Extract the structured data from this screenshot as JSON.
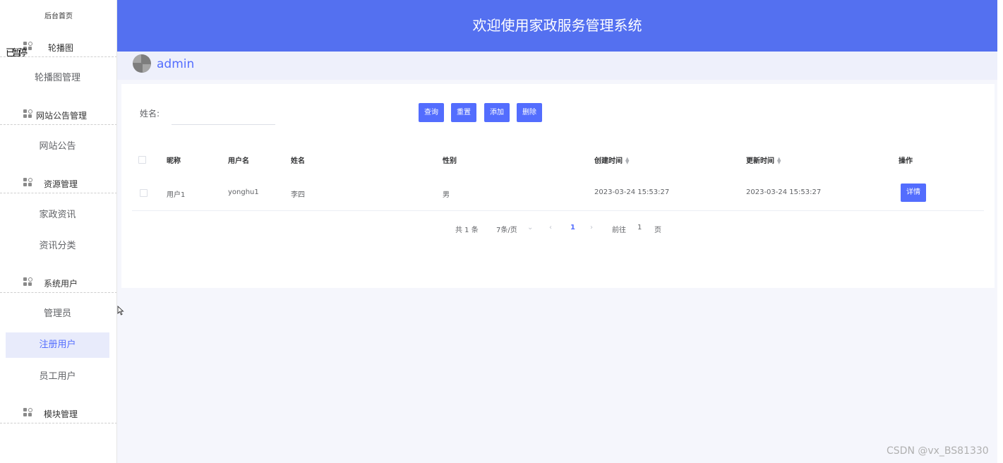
{
  "sidebar": {
    "home": "后台首页",
    "overlay_text": "已暂停",
    "groups": [
      {
        "label": "轮播图",
        "items": [
          "轮播图管理"
        ]
      },
      {
        "label": "网站公告管理",
        "items": [
          "网站公告"
        ]
      },
      {
        "label": "资源管理",
        "items": [
          "家政资讯",
          "资讯分类"
        ]
      },
      {
        "label": "系统用户",
        "items": [
          "管理员",
          "注册用户",
          "员工用户"
        ]
      },
      {
        "label": "模块管理",
        "items": []
      }
    ],
    "active_item": "注册用户"
  },
  "header": {
    "title": "欢迎使用家政服务管理系统"
  },
  "user": {
    "name": "admin"
  },
  "search": {
    "label": "姓名:",
    "value": "",
    "placeholder": ""
  },
  "toolbar": {
    "query": "查询",
    "reset": "重置",
    "add": "添加",
    "delete": "删除"
  },
  "table": {
    "columns": [
      "昵称",
      "用户名",
      "姓名",
      "性别",
      "创建时间",
      "更新时间",
      "操作"
    ],
    "rows": [
      {
        "nickname": "用户1",
        "username": "yonghu1",
        "name": "李四",
        "gender": "男",
        "created": "2023-03-24 15:53:27",
        "updated": "2023-03-24 15:53:27",
        "action": "详情"
      }
    ]
  },
  "pagination": {
    "total": "共 1 条",
    "page_size": "7条/页",
    "current": "1",
    "goto_label": "前往",
    "goto_value": "1",
    "page_unit": "页"
  },
  "watermark": "CSDN @vx_BS81330",
  "colors": {
    "accent": "#536dfe",
    "header_bg": "#5470f0"
  }
}
